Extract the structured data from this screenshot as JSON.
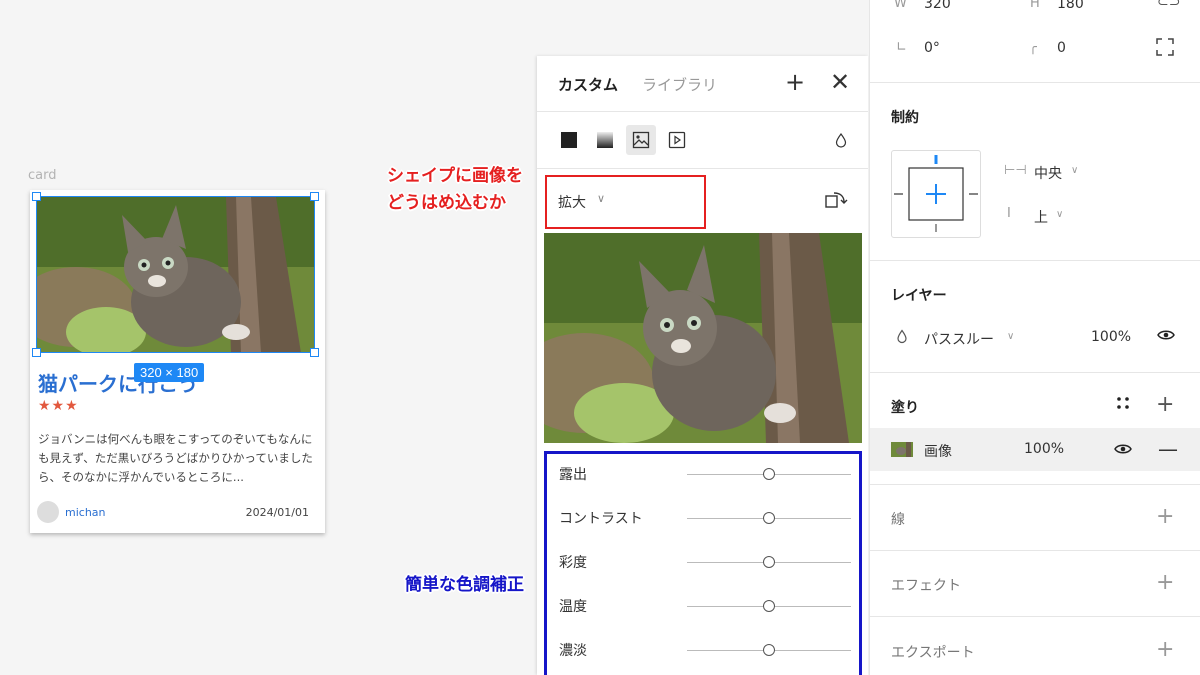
{
  "canvas": {
    "frame_label": "card",
    "selection_size": "320 × 180",
    "card": {
      "title": "猫パークに行こう",
      "stars": "★★★",
      "body": "ジョバンニは何べんも眼をこすってのぞいてもなんにも見えず、ただ黒いびろうどばかりひかっていましたら、そのなかに浮かんでいるところに...",
      "user": "michan",
      "date": "2024/01/01"
    }
  },
  "popup": {
    "tab_custom": "カスタム",
    "tab_library": "ライブラリ",
    "scale_mode": "拡大",
    "adjustments": [
      {
        "label": "露出",
        "value": 0
      },
      {
        "label": "コントラスト",
        "value": 0
      },
      {
        "label": "彩度",
        "value": 0
      },
      {
        "label": "温度",
        "value": 0
      },
      {
        "label": "濃淡",
        "value": 0
      }
    ]
  },
  "annotations": {
    "red_line1": "シェイプに画像を",
    "red_line2": "どうはめ込むか",
    "blue": "簡単な色調補正",
    "red_color": "#e52020",
    "blue_color": "#1616c8"
  },
  "props": {
    "w_label": "W",
    "w_value": "320",
    "h_label": "H",
    "h_value": "180",
    "rotation": "0°",
    "radius": "0",
    "constraints_title": "制約",
    "constraint_h": "中央",
    "constraint_v": "上",
    "layer_title": "レイヤー",
    "blend_mode": "パススルー",
    "layer_opacity": "100%",
    "fill_title": "塗り",
    "fill_type": "画像",
    "fill_opacity": "100%",
    "stroke_title": "線",
    "effect_title": "エフェクト",
    "export_title": "エクスポート"
  },
  "colors": {
    "accent": "#1e88f5",
    "card_title": "#2a6fd1",
    "stars": "#e2583e"
  }
}
